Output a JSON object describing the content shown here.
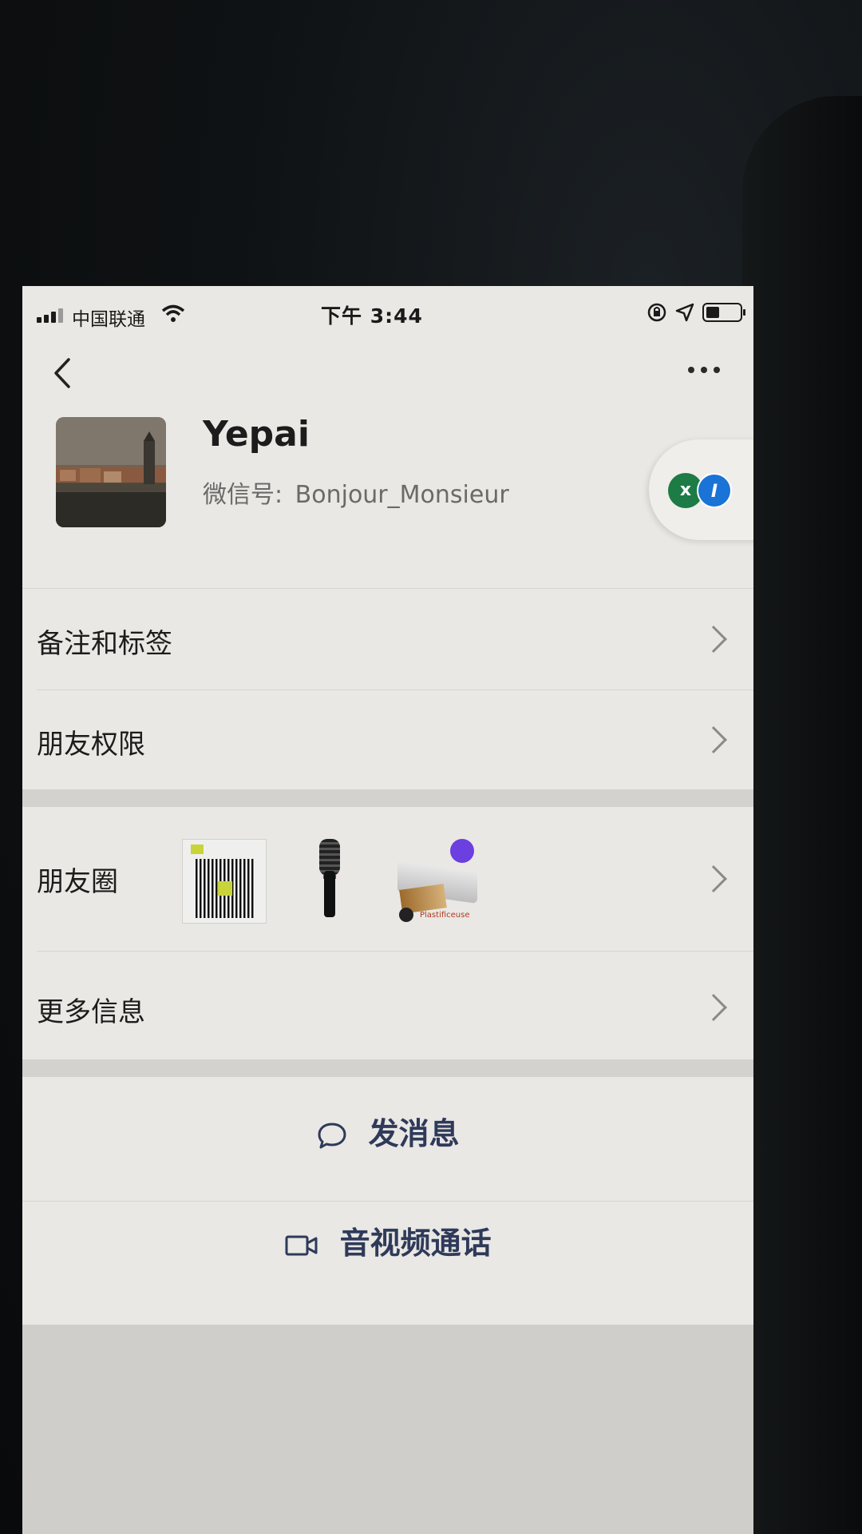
{
  "status_bar": {
    "carrier": "中国联通",
    "time": "下午 3:44"
  },
  "profile": {
    "nickname": "Yepai",
    "wechat_id_label": "微信号:",
    "wechat_id": "Bonjour_Monsieur"
  },
  "menu": {
    "remark_tags": "备注和标签",
    "friend_permissions": "朋友权限",
    "moments": "朋友圈",
    "more_info": "更多信息"
  },
  "moments_thumbs": {
    "laminator_brand": "Plastificeuse"
  },
  "actions": {
    "send_message": "发消息",
    "av_call": "音视频通话"
  },
  "colors": {
    "screen_bg": "#e9e8e4",
    "action_text": "#2f3a5a",
    "badge_green": "#1d7b45",
    "badge_blue": "#1a73d6"
  }
}
